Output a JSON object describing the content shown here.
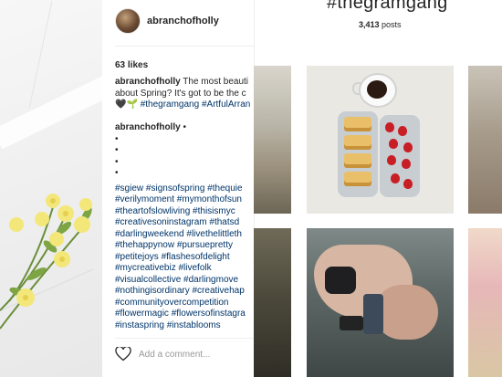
{
  "post": {
    "username": "abranchofholly",
    "likes": "63 likes",
    "caption_user": "abranchofholly",
    "caption_line1": "The most beauti",
    "caption_line2": "about Spring? It's got to be the c",
    "caption_line3_emoji": "🖤🌱",
    "caption_line3_tags": "#thegramgang #ArtfulArran"
  },
  "comment": {
    "username": "abranchofholly",
    "suffix": "•",
    "bullets": [
      "",
      "",
      "",
      ""
    ],
    "tag_lines": [
      "#sgiew #signsofspring #thequie",
      "#verilymoment #mymonthofsun",
      "#theartofslowliving #thisismyc",
      "#creativesoninstagram #thatsd",
      "#darlingweekend #livethelittleth",
      "#thehappynow #pursuepretty",
      "#petitejoys #flashesofdelight",
      "#mycreativebiz #livefolk",
      "#visualcollective #darlingmove",
      "#nothingisordinary #creativehap",
      "#communityovercompetition",
      "#flowermagic #flowersofinstagra",
      "#instaspring #instablooms"
    ]
  },
  "add_comment_placeholder": "Add a comment...",
  "hashtag_page": {
    "title": "#thegramgang",
    "post_count": "3,413",
    "post_count_label": "posts"
  },
  "icons": {
    "heart": "heart-icon"
  }
}
